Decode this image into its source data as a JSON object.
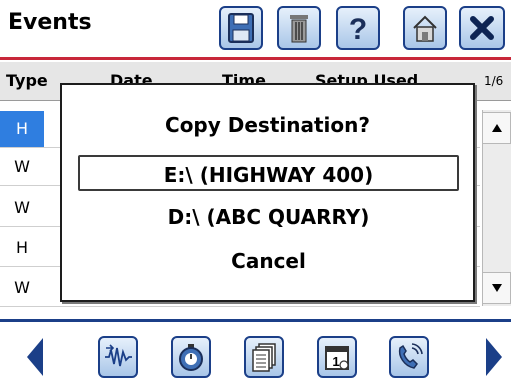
{
  "header": {
    "title": "Events",
    "toolbar": [
      "save-icon",
      "trash-icon",
      "help-icon",
      "home-icon",
      "close-icon"
    ]
  },
  "table": {
    "columns": [
      "Type",
      "Date",
      "Time",
      "Setup Used"
    ],
    "page_indicator": "1/6",
    "rows": [
      {
        "type": "H",
        "selected": true
      },
      {
        "type": "W",
        "selected": false
      },
      {
        "type": "W",
        "selected": false
      },
      {
        "type": "H",
        "selected": false
      },
      {
        "type": "W",
        "selected": false
      }
    ]
  },
  "dialog": {
    "title": "Copy Destination?",
    "options": [
      "E:\\ (HIGHWAY 400)",
      "D:\\ (ABC QUARRY)",
      "Cancel"
    ],
    "focused_index": 0
  },
  "footer": {
    "buttons": [
      "waveform-icon",
      "stopwatch-icon",
      "documents-icon",
      "calendar-icon",
      "phone-icon"
    ],
    "colors": {
      "accent": "#1b3f88",
      "header_rule": "#c8283a",
      "selection": "#2f7ee0"
    }
  }
}
